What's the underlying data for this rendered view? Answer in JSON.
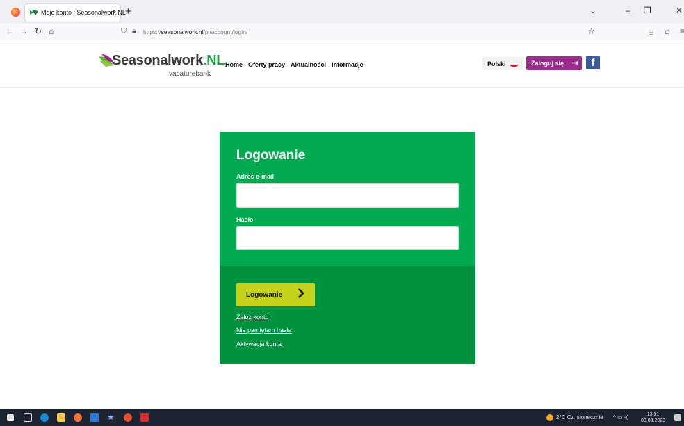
{
  "browser": {
    "tab_title": "Moje konto | Seasonalwork.NL",
    "tab_close": "×",
    "new_tab": "+",
    "url_prefix": "https://",
    "url_domain": "seasonalwork.nl",
    "url_path": "/pl/account/login/",
    "nav_icons": [
      "back-arrow-icon",
      "forward-arrow-icon",
      "reload-icon",
      "home-icon"
    ],
    "window_controls": [
      "chevron-down-icon",
      "minimize-icon",
      "restore-icon",
      "close-icon"
    ]
  },
  "site": {
    "logo_main": "Seasonalwork",
    "logo_accent": ".NL",
    "logo_sub": "vacaturebank",
    "menu": [
      "Home",
      "Oferty pracy",
      "Aktualności",
      "Informacje"
    ],
    "language": "Polski",
    "login_button": "Zaloguj się",
    "facebook": "f"
  },
  "login": {
    "title": "Logowanie",
    "email_label": "Adres e-mail",
    "email_value": "",
    "password_label": "Hasło",
    "password_value": "",
    "submit_label": "Logowanie",
    "links": [
      "Załóż konto",
      "Nie pamiętam hasła",
      "Aktywacja konta"
    ]
  },
  "taskbar": {
    "weather": "2°C  Cz. słonecznie",
    "time": "13:51",
    "date": "08.03.2023"
  },
  "colors": {
    "card_green": "#00a84f",
    "card_green_dark": "#00933f",
    "submit_yellow": "#c5d21c",
    "login_purple": "#9b2d8e",
    "facebook_blue": "#3b5998",
    "logo_green": "#2aa148"
  }
}
